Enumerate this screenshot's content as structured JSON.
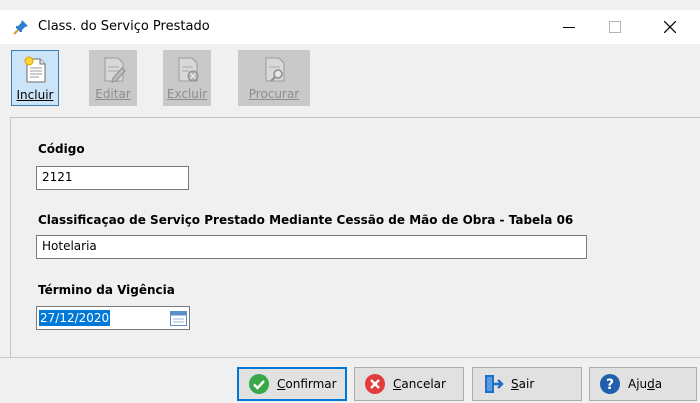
{
  "window": {
    "title": "Class. do Serviço Prestado",
    "controls": [
      "minimize",
      "maximize",
      "close"
    ]
  },
  "toolbar": {
    "buttons": [
      {
        "label": "Incluir",
        "icon": "new-document-icon",
        "enabled": true
      },
      {
        "label": "Editar",
        "icon": "edit-document-icon",
        "enabled": false
      },
      {
        "label": "Excluir",
        "icon": "delete-document-icon",
        "enabled": false
      },
      {
        "label": "Procurar",
        "icon": "search-document-icon",
        "enabled": false
      }
    ]
  },
  "form": {
    "codigo": {
      "label": "Código",
      "value": "2121"
    },
    "classificacao": {
      "label": "Classificaçao de Serviço Prestado Mediante Cessão de Mão de Obra - Tabela 06",
      "value": "Hotelaria"
    },
    "termino": {
      "label": "Término da Vigência",
      "value": "27/12/2020"
    }
  },
  "footer": {
    "buttons": [
      {
        "label": "Confirmar",
        "underline_char": "C",
        "rest": "onfirmar",
        "icon": "check-icon",
        "color": "#3aa849"
      },
      {
        "label": "Cancelar",
        "underline_char": "C",
        "rest": "ancelar",
        "icon": "cancel-icon",
        "color": "#e23b3b"
      },
      {
        "label": "Sair",
        "underline_char": "S",
        "rest": "air",
        "icon": "exit-icon",
        "color": "#1f6fc5"
      },
      {
        "label": "Ajuda",
        "prefix": "Aju",
        "underline_char": "d",
        "rest": "a",
        "icon": "help-icon",
        "color": "#1f5fae"
      }
    ]
  }
}
